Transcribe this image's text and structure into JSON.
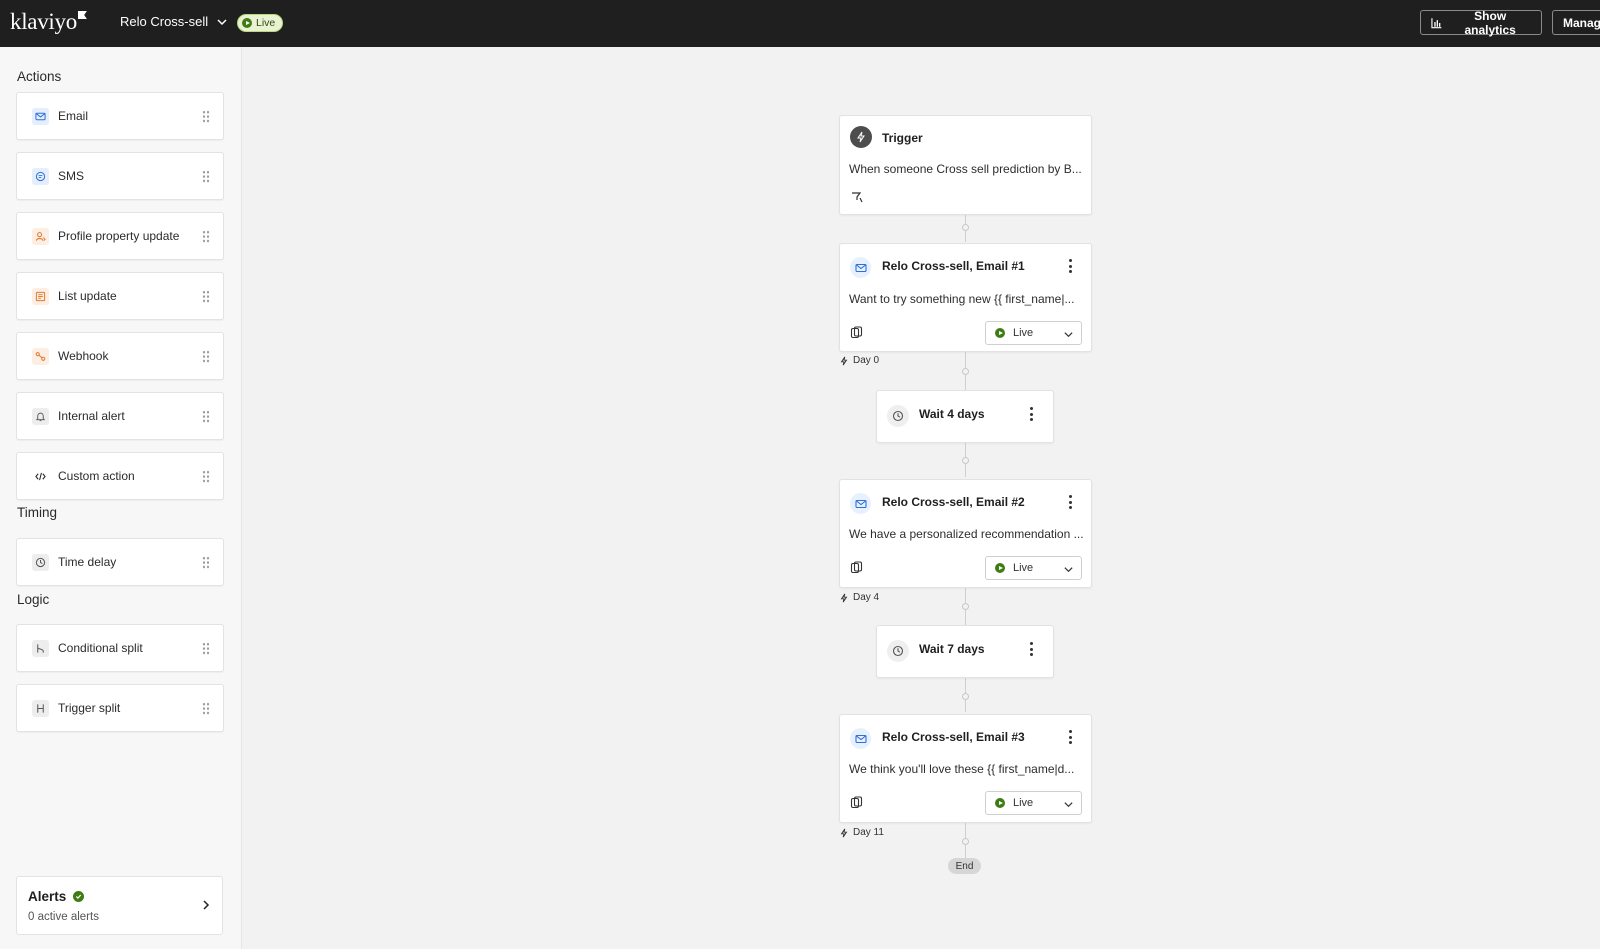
{
  "topbar": {
    "logo": "klaviyo",
    "flow_name": "Relo Cross-sell",
    "status": "Live",
    "show_analytics": "Show analytics",
    "manage": "Manag"
  },
  "sidebar": {
    "sections": {
      "actions": "Actions",
      "timing": "Timing",
      "logic": "Logic"
    },
    "actions": [
      {
        "label": "Email",
        "icon": "mail-icon"
      },
      {
        "label": "SMS",
        "icon": "sms-icon"
      },
      {
        "label": "Profile property update",
        "icon": "profile-icon"
      },
      {
        "label": "List update",
        "icon": "list-icon"
      },
      {
        "label": "Webhook",
        "icon": "webhook-icon"
      },
      {
        "label": "Internal alert",
        "icon": "bell-icon"
      },
      {
        "label": "Custom action",
        "icon": "code-icon"
      }
    ],
    "timing": [
      {
        "label": "Time delay",
        "icon": "clock-icon"
      }
    ],
    "logic": [
      {
        "label": "Conditional split",
        "icon": "split-icon"
      },
      {
        "label": "Trigger split",
        "icon": "trigger-split-icon"
      }
    ],
    "alerts": {
      "title": "Alerts",
      "subtitle": "0 active alerts"
    }
  },
  "flow": {
    "trigger": {
      "title": "Trigger",
      "description": "When someone Cross sell prediction by B..."
    },
    "emails": [
      {
        "title": "Relo Cross-sell, Email #1",
        "description": "Want to try something new {{ first_name|...",
        "status": "Live",
        "day": "Day 0"
      },
      {
        "title": "Relo Cross-sell, Email #2",
        "description": "We have a personalized recommendation ...",
        "status": "Live",
        "day": "Day 4"
      },
      {
        "title": "Relo Cross-sell, Email #3",
        "description": "We think you'll love these {{ first_name|d...",
        "status": "Live",
        "day": "Day 11"
      }
    ],
    "waits": [
      {
        "label": "Wait 4 days"
      },
      {
        "label": "Wait 7 days"
      }
    ],
    "end": "End"
  },
  "colors": {
    "topbar": "#1f1f20",
    "live_green": "#3f7d14",
    "canvas": "#f2f2f2"
  }
}
